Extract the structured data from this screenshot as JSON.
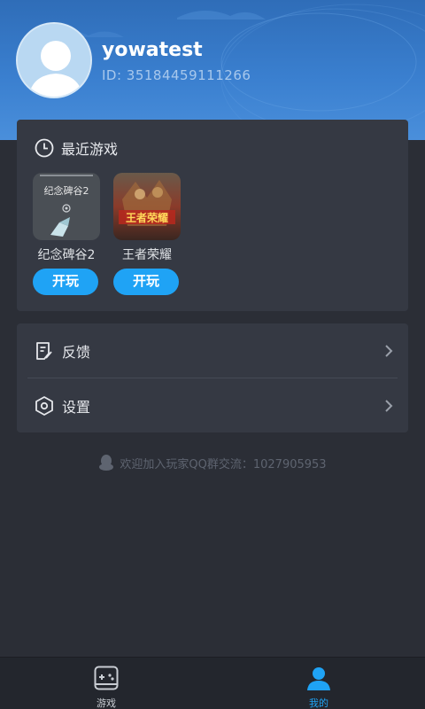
{
  "profile": {
    "username": "yowatest",
    "user_id": "ID:  35184459111266"
  },
  "recent": {
    "title": "最近游戏",
    "games": [
      {
        "name": "纪念碑谷2",
        "thumb_text": "纪念碑谷2",
        "play_label": "开玩"
      },
      {
        "name": "王者荣耀",
        "thumb_text": "王者荣耀",
        "play_label": "开玩"
      }
    ]
  },
  "menu": {
    "feedback_label": "反馈",
    "settings_label": "设置"
  },
  "qq_note": "欢迎加入玩家QQ群交流：1027905953",
  "tabbar": {
    "games_label": "游戏",
    "mine_label": "我的"
  },
  "colors": {
    "accent": "#1fa3f5",
    "header": "#3a7fcf",
    "background": "#2b2e36",
    "card": "#353943"
  }
}
